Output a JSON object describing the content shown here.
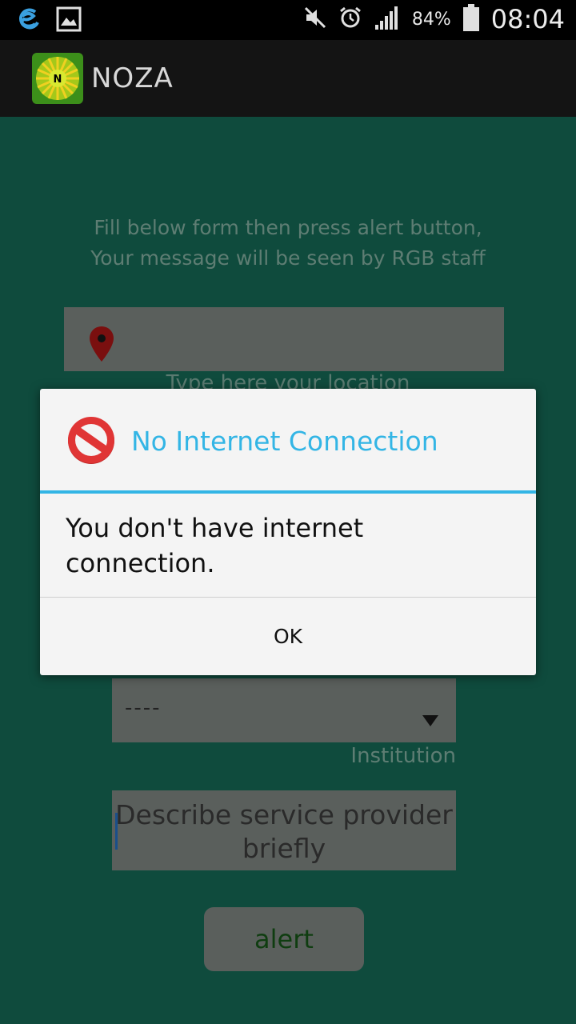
{
  "status_bar": {
    "icons_left": [
      "sync-icon",
      "gallery-icon"
    ],
    "icons_right": [
      "mute-icon",
      "alarm-icon",
      "signal-icon",
      "battery-icon"
    ],
    "battery": "84%",
    "time": "08:04"
  },
  "action_bar": {
    "logo_letter": "N",
    "title": "NOZA"
  },
  "form": {
    "instructions_line1": "Fill below form then press alert button,",
    "instructions_line2": "Your message will be seen by RGB staff",
    "location_hint": "Type here your location",
    "institution_value": "----",
    "institution_label": "Institution",
    "description_placeholder_line1": "Describe service provider",
    "description_placeholder_line2": "briefly",
    "alert_button": "alert"
  },
  "dialog": {
    "icon": "no-entry-icon",
    "title": "No Internet Connection",
    "message": "You don't have internet connection.",
    "ok_button": "OK"
  },
  "colors": {
    "dialog_accent": "#33b5e5",
    "content_background": "#0f4b3d",
    "action_bar": "#141414"
  }
}
